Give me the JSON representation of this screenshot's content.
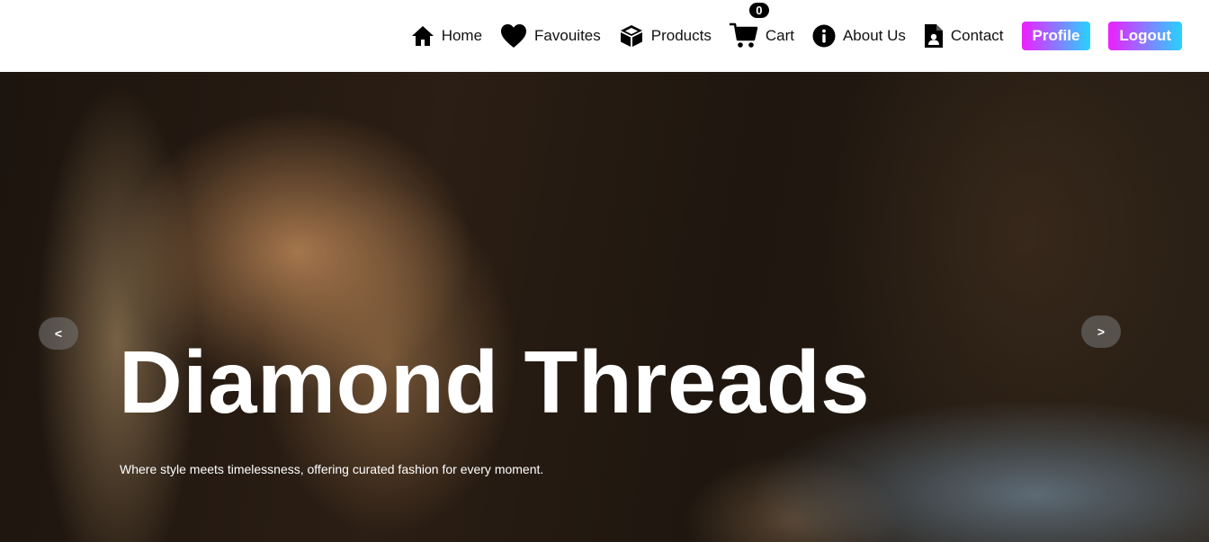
{
  "nav": {
    "home": "Home",
    "favourites": "Favouites",
    "products": "Products",
    "cart": "Cart",
    "cart_count": "0",
    "about": "About Us",
    "contact": "Contact",
    "profile_button": "Profile",
    "logout_button": "Logout",
    "icons": [
      "home-icon",
      "heart-icon",
      "box-icon",
      "cart-icon",
      "info-icon",
      "contact-file-icon"
    ]
  },
  "hero": {
    "title": "Diamond Threads",
    "subtitle": "Where style meets timelessness, offering curated fashion for every moment.",
    "prev_arrow": "<",
    "next_arrow": ">"
  },
  "colors": {
    "button_gradient_start": "#ee1eff",
    "button_gradient_end": "#26d4ff",
    "text": "#111111"
  }
}
